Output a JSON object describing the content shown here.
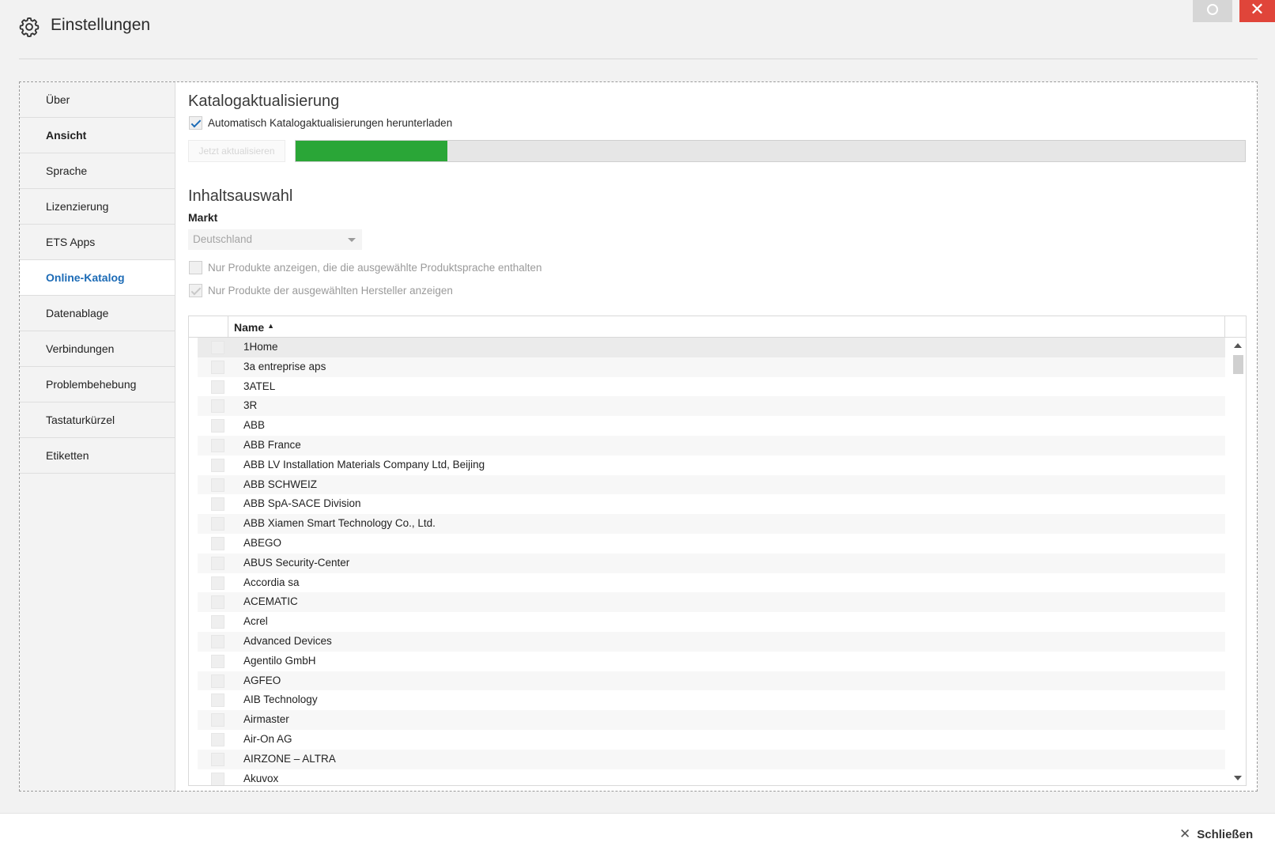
{
  "window": {
    "title": "Einstellungen",
    "title_icon": "gear-icon",
    "close_glyph": "✕"
  },
  "sidebar": {
    "items": [
      {
        "label": "Über"
      },
      {
        "label": "Ansicht"
      },
      {
        "label": "Sprache"
      },
      {
        "label": "Lizenzierung"
      },
      {
        "label": "ETS Apps"
      },
      {
        "label": "Online-Katalog"
      },
      {
        "label": "Datenablage"
      },
      {
        "label": "Verbindungen"
      },
      {
        "label": "Problembehebung"
      },
      {
        "label": "Tastaturkürzel"
      },
      {
        "label": "Etiketten"
      }
    ],
    "active": "Online-Katalog"
  },
  "catalog_update": {
    "heading": "Katalogaktualisierung",
    "auto_download_label": "Automatisch Katalogaktualisierungen herunterladen",
    "auto_download_checked": true,
    "update_button": "Jetzt aktualisieren",
    "progress_fraction": 0.16
  },
  "content_selection": {
    "heading": "Inhaltsauswahl",
    "market_label": "Markt",
    "market_value": "Deutschland",
    "option_language_label": "Nur Produkte anzeigen, die die ausgewählte Produktsprache enthalten",
    "option_language_checked": false,
    "option_manufacturer_label": "Nur Produkte der ausgewählten Hersteller anzeigen",
    "option_manufacturer_checked": true
  },
  "table": {
    "column_name": "Name",
    "sort_glyph": "▲",
    "rows": [
      "1Home",
      "3a entreprise aps",
      "3ATEL",
      "3R",
      "ABB",
      "ABB France",
      "ABB LV Installation Materials Company Ltd, Beijing",
      "ABB SCHWEIZ",
      "ABB SpA-SACE Division",
      "ABB Xiamen Smart Technology Co., Ltd.",
      "ABEGO",
      "ABUS Security-Center",
      "Accordia sa",
      "ACEMATIC",
      "Acrel",
      "Advanced Devices",
      "Agentilo GmbH",
      "AGFEO",
      "AIB Technology",
      "Airmaster",
      "Air-On AG",
      "AIRZONE – ALTRA",
      "Akuvox"
    ]
  },
  "footer": {
    "close_label": "Schließen",
    "close_glyph": "✕"
  }
}
